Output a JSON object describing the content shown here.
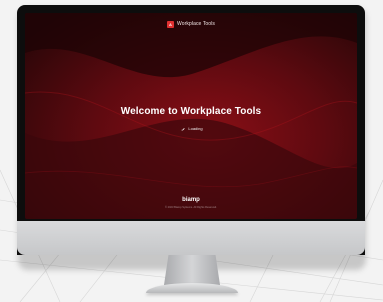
{
  "app": {
    "logo_letter": "A",
    "title": "Workplace Tools"
  },
  "main": {
    "welcome_text": "Welcome to Workplace Tools",
    "loading_text": "Loading"
  },
  "footer": {
    "brand": "biamp",
    "copyright": "© 2023 Biamp Systems. All Rights Reserved."
  },
  "colors": {
    "accent": "#e03030",
    "background_dark": "#2a0608",
    "background_red": "#8a0f16"
  },
  "icons": {
    "app_logo": "app-logo-icon",
    "spinner": "spinner-icon"
  }
}
